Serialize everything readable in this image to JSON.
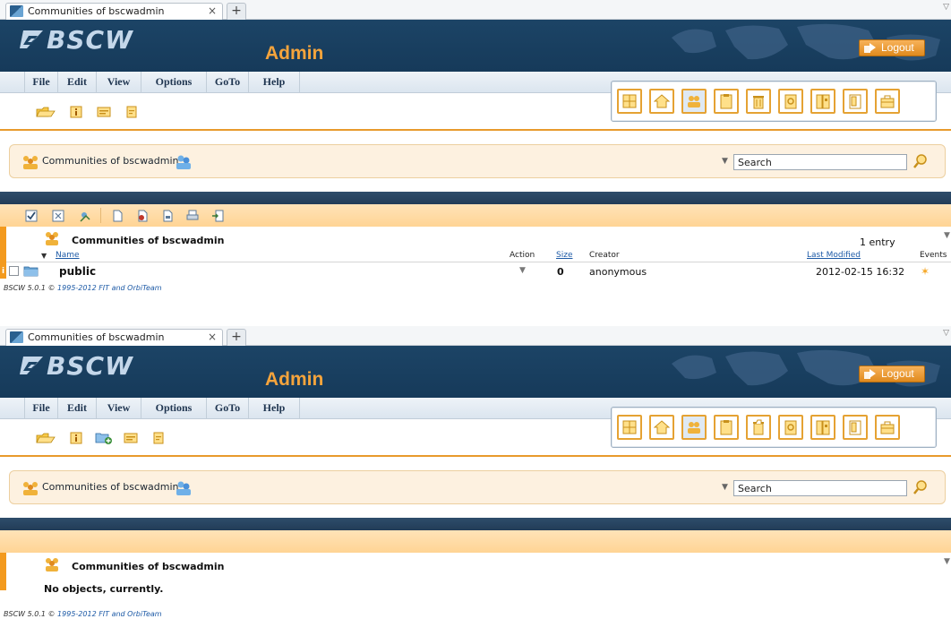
{
  "browser": {
    "tab_title": "Communities of bscwadmin",
    "tab_close": "×",
    "new_tab": "+"
  },
  "header": {
    "logo": "BSCW",
    "title": "Admin",
    "logout_label": "Logout"
  },
  "menu": [
    "File",
    "Edit",
    "View",
    "Options",
    "GoTo",
    "Help"
  ],
  "breadcrumb": {
    "text": "Communities of bscwadmin"
  },
  "search": {
    "value": "Search"
  },
  "colors": {
    "header_bg": "#1c4466",
    "accent_orange": "#f39a1e",
    "admin_title": "#f5a43c",
    "crumb_bg": "#fdf1e0"
  },
  "shot1": {
    "listing_title": "Communities of bscwadmin",
    "count": "1 entry",
    "columns": {
      "name": "Name",
      "action": "Action",
      "size": "Size",
      "creator": "Creator",
      "last_modified": "Last Modified",
      "events": "Events"
    },
    "rows": [
      {
        "name": "public",
        "size": "0",
        "creator": "anonymous",
        "last_modified": "2012-02-15 16:32"
      }
    ]
  },
  "shot2": {
    "listing_title": "Communities of bscwadmin",
    "empty_message": "No objects, currently."
  },
  "footer": {
    "prefix": "BSCW 5.0.1 © ",
    "link": "1995-2012 FIT and OrbiTeam"
  }
}
